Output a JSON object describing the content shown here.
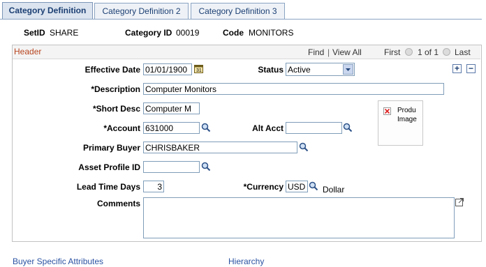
{
  "tabs": [
    {
      "label": "Category Definition"
    },
    {
      "label": "Category Definition 2"
    },
    {
      "label": "Category Definition 3"
    }
  ],
  "key": {
    "setid_label": "SetID",
    "setid_value": "SHARE",
    "category_id_label": "Category ID",
    "category_id_value": "00019",
    "code_label": "Code",
    "code_value": "MONITORS"
  },
  "header": {
    "title": "Header",
    "find": "Find",
    "separator": "|",
    "view_all": "View All",
    "first": "First",
    "range": "1 of 1",
    "last": "Last"
  },
  "form": {
    "effective_date_label": "Effective Date",
    "effective_date_value": "01/01/1900",
    "status_label": "Status",
    "status_value": "Active",
    "description_label": "*Description",
    "description_value": "Computer Monitors",
    "short_desc_label": "*Short Desc",
    "short_desc_value": "Computer M",
    "account_label": "*Account",
    "account_value": "631000",
    "alt_acct_label": "Alt Acct",
    "alt_acct_value": "",
    "primary_buyer_label": "Primary Buyer",
    "primary_buyer_value": "CHRISBAKER",
    "asset_profile_label": "Asset Profile ID",
    "asset_profile_value": "",
    "lead_time_label": "Lead Time Days",
    "lead_time_value": "3",
    "currency_label": "*Currency",
    "currency_value": "USD",
    "currency_desc": "Dollar",
    "comments_label": "Comments",
    "comments_value": "",
    "product_image_line1": "Produ",
    "product_image_line2": "Image"
  },
  "links": {
    "buyer_specific": "Buyer Specific Attributes",
    "hierarchy": "Hierarchy"
  },
  "colors": {
    "header_title": "#b7451f",
    "link": "#2a52a2",
    "tab_text": "#1c3f73"
  }
}
